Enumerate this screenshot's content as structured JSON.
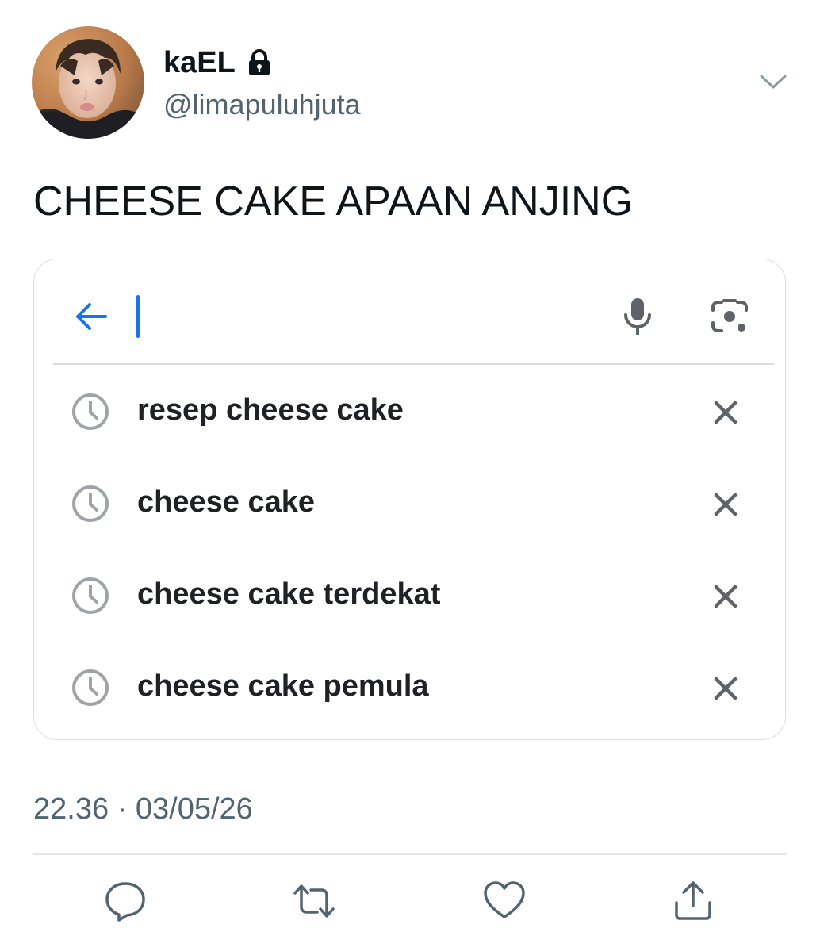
{
  "user": {
    "display_name": "kaEL",
    "handle": "@limapuluhjuta",
    "lock_icon": "lock-icon",
    "avatar": "profile-photo"
  },
  "tweet": {
    "text": "CHEESE CAKE APAAN ANJING",
    "timestamp": "22.36 · 03/05/26"
  },
  "search_card": {
    "query": "",
    "accent_color": "#1a73e8",
    "icons": [
      "back-arrow-icon",
      "mic-icon",
      "camera-lens-icon"
    ],
    "suggestions": [
      {
        "text": "resep cheese cake",
        "icon": "history-clock-icon"
      },
      {
        "text": "cheese cake",
        "icon": "history-clock-icon"
      },
      {
        "text": "cheese cake terdekat",
        "icon": "history-clock-icon"
      },
      {
        "text": "cheese cake pemula",
        "icon": "history-clock-icon"
      }
    ]
  },
  "actions": [
    "reply-icon",
    "retweet-icon",
    "like-icon",
    "share-icon"
  ],
  "colors": {
    "text_primary": "#0f1419",
    "text_secondary": "#536471",
    "icon_gray": "#5f6368"
  }
}
